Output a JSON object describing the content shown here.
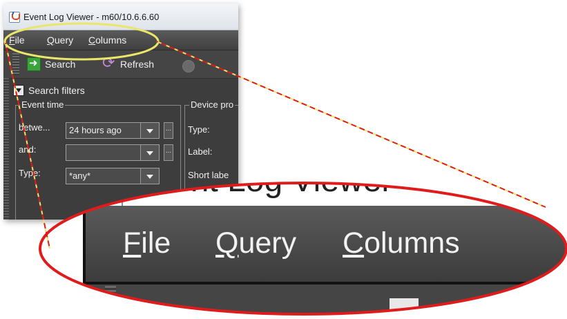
{
  "window": {
    "title": "Event Log Viewer - m60/10.6.6.60"
  },
  "menu": {
    "items": [
      "File",
      "Query",
      "Columns"
    ]
  },
  "toolbar": {
    "search_label": "Search",
    "refresh_label": "Refresh"
  },
  "filters": {
    "header": "Search filters",
    "event_time": {
      "title": "Event time",
      "between_label": "betwe...",
      "between_value": "24 hours ago",
      "and_label": "and:",
      "and_value": "",
      "type_label": "Type:",
      "type_value": "*any*",
      "ellipsis": "..."
    },
    "device_props": {
      "title": "Device pro",
      "type_label": "Type:",
      "label_label": "Label:",
      "short_label_label": "Short labe"
    }
  },
  "zoom": {
    "title": "Event Log Viewer",
    "menu_items": [
      "File",
      "Query",
      "Columns"
    ]
  },
  "colors": {
    "highlight_outline": "#e9e66a",
    "callout_outline": "#e01b1b",
    "menubar": "#4a4a4a"
  }
}
